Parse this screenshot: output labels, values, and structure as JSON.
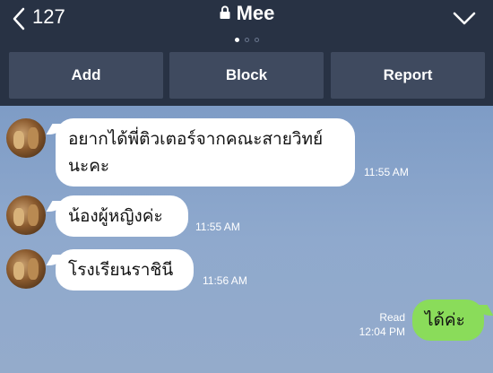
{
  "header": {
    "back_count": "127",
    "title": "Mee",
    "page_dots": 3,
    "active_dot": 0
  },
  "actions": {
    "add": "Add",
    "block": "Block",
    "report": "Report"
  },
  "messages": [
    {
      "direction": "incoming",
      "text_line1": "อยากได้พี่ติวเตอร์จากคณะสายวิทย์",
      "text_line2": "นะคะ",
      "time": "11:55 AM"
    },
    {
      "direction": "incoming",
      "text": "น้องผู้หญิงค่ะ",
      "time": "11:55 AM"
    },
    {
      "direction": "incoming",
      "text": "โรงเรียนราชินี",
      "time": "11:56 AM"
    },
    {
      "direction": "outgoing",
      "text": "ได้ค่ะ",
      "status": "Read",
      "time": "12:04 PM"
    }
  ],
  "colors": {
    "header_bg": "#283244",
    "button_bg": "#3f4a5f",
    "chat_bg": "#8aa6cc",
    "incoming_bubble": "#ffffff",
    "outgoing_bubble": "#8adc5a"
  },
  "icons": {
    "back": "chevron-left-icon",
    "lock": "lock-icon",
    "menu": "chevron-down-icon"
  }
}
